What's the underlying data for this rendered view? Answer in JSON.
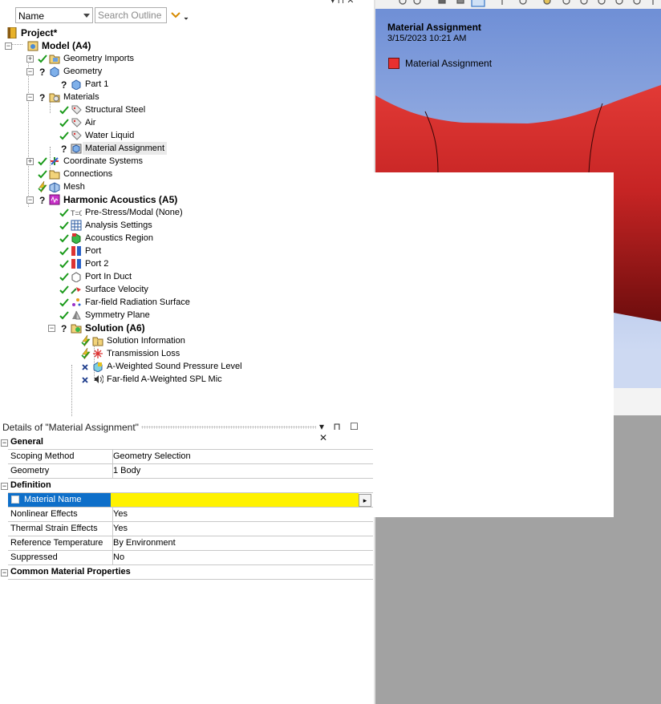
{
  "outline": {
    "filter_combo": "Name",
    "search_placeholder": "Search Outline",
    "top_glyphs": "▾  ⊓ ✕",
    "tree": [
      {
        "label": "Project*",
        "bold": true
      },
      {
        "label": "Model (A4)",
        "bold": true
      },
      {
        "label": "Geometry Imports"
      },
      {
        "label": "Geometry"
      },
      {
        "label": "Part 1"
      },
      {
        "label": "Materials"
      },
      {
        "label": "Structural Steel"
      },
      {
        "label": "Air"
      },
      {
        "label": "Water Liquid"
      },
      {
        "label": "Material Assignment",
        "selected": true
      },
      {
        "label": "Coordinate Systems"
      },
      {
        "label": "Connections"
      },
      {
        "label": "Mesh"
      },
      {
        "label": "Harmonic Acoustics (A5)",
        "bold": true
      },
      {
        "label": "Pre-Stress/Modal (None)"
      },
      {
        "label": "Analysis Settings"
      },
      {
        "label": "Acoustics Region"
      },
      {
        "label": "Port"
      },
      {
        "label": "Port 2"
      },
      {
        "label": "Port In Duct"
      },
      {
        "label": "Surface Velocity"
      },
      {
        "label": "Far-field Radiation Surface"
      },
      {
        "label": "Symmetry Plane"
      },
      {
        "label": "Solution (A6)",
        "bold": true
      },
      {
        "label": "Solution Information"
      },
      {
        "label": "Transmission Loss"
      },
      {
        "label": "A-Weighted Sound Pressure Level"
      },
      {
        "label": "Far-field A-Weighted SPL Mic"
      }
    ],
    "expander_symbols": {
      "plus": "+",
      "minus": "−"
    }
  },
  "details": {
    "title": "Details of \"Material Assignment\"",
    "controls": "▾ ⊓ ☐ ✕",
    "sections": {
      "general": "General",
      "definition": "Definition",
      "common": "Common Material Properties"
    },
    "rows": {
      "scoping_method": {
        "key": "Scoping Method",
        "value": "Geometry Selection"
      },
      "geometry": {
        "key": "Geometry",
        "value": "1 Body"
      },
      "material_name": {
        "key": "Material Name",
        "value": ""
      },
      "nonlinear": {
        "key": "Nonlinear Effects",
        "value": "Yes"
      },
      "thermal": {
        "key": "Thermal Strain Effects",
        "value": "Yes"
      },
      "ref_temp": {
        "key": "Reference Temperature",
        "value": "By Environment"
      },
      "suppressed": {
        "key": "Suppressed",
        "value": "No"
      }
    },
    "arrow": "▸"
  },
  "viewport": {
    "title": "Material Assignment",
    "date": "3/15/2023 10:21 AM",
    "legend_label": "Material Assignment",
    "legend_color": "#e8302f",
    "model_color": "#d32a2a"
  }
}
